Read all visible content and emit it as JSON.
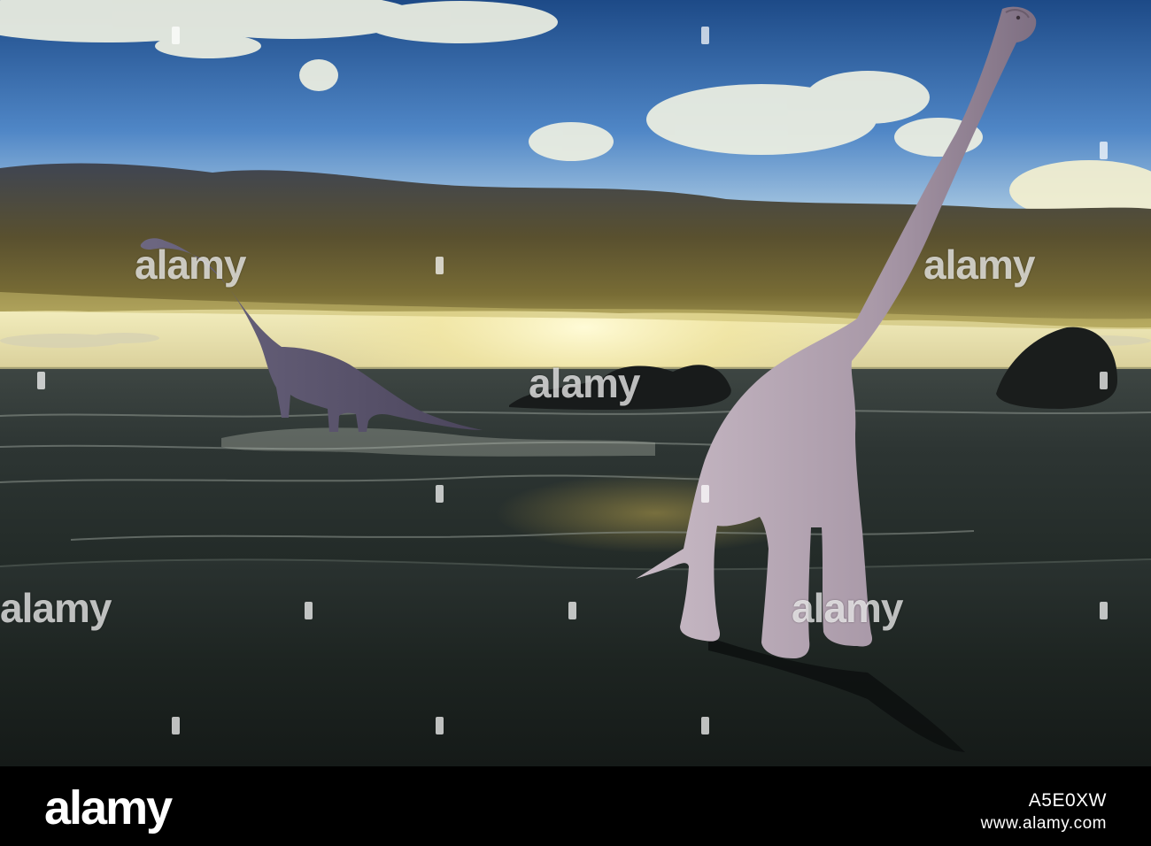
{
  "photo": {
    "subject": "Two sauropod dinosaurs on a beach at sunset",
    "colors": {
      "sky_top": "#1f4d8a",
      "sky_horizon": "#f6f0b8",
      "cloud_band": "#4a4229",
      "sea": "#2b3230",
      "sand": "#1a1f1c",
      "dinosaur_near": "#b7a7b4",
      "dinosaur_far": "#5f5871"
    }
  },
  "watermarks": {
    "text": "alamy",
    "marks": [
      "alamy",
      "alamy",
      "alamy",
      "alamy",
      "alamy",
      "alamy",
      "alamy",
      "alamy",
      "alamy",
      "alamy",
      "alamy",
      "alamy"
    ]
  },
  "footer": {
    "brand": "alamy",
    "stock_id": "A5E0XW",
    "url": "www.alamy.com"
  }
}
